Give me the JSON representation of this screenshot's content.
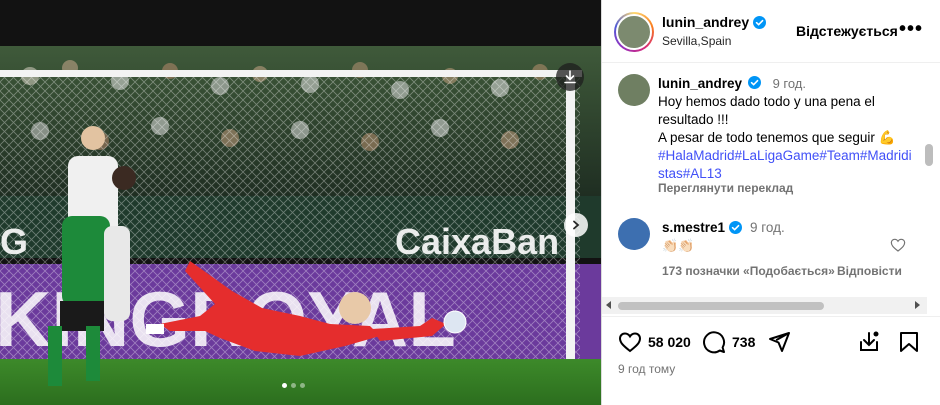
{
  "post": {
    "author": "lunin_andrey",
    "location": "Sevilla,Spain",
    "follow_label": "Відстежується",
    "more_label": "•••",
    "caption": {
      "username": "lunin_andrey",
      "time": "9 год.",
      "lines": [
        "Hoy hemos dado todo y una pena el resultado !!!",
        "A pesar de todo tenemos que seguir 💪"
      ],
      "hashtags": "#HalaMadrid#LaLigaGame#Team#Madridistas#AL13",
      "translate_label": "Переглянути переклад"
    },
    "comment": {
      "username": "s.mestre1",
      "time": "9 год.",
      "text": "👏🏻👏🏻",
      "likes_label": "173 позначки «Подобається»",
      "reply_label": "Відповісти"
    },
    "likes_count": "58 020",
    "comments_count": "738",
    "time_ago": "9 год тому"
  },
  "media": {
    "carousel_index": 0,
    "carousel_total": 3
  }
}
